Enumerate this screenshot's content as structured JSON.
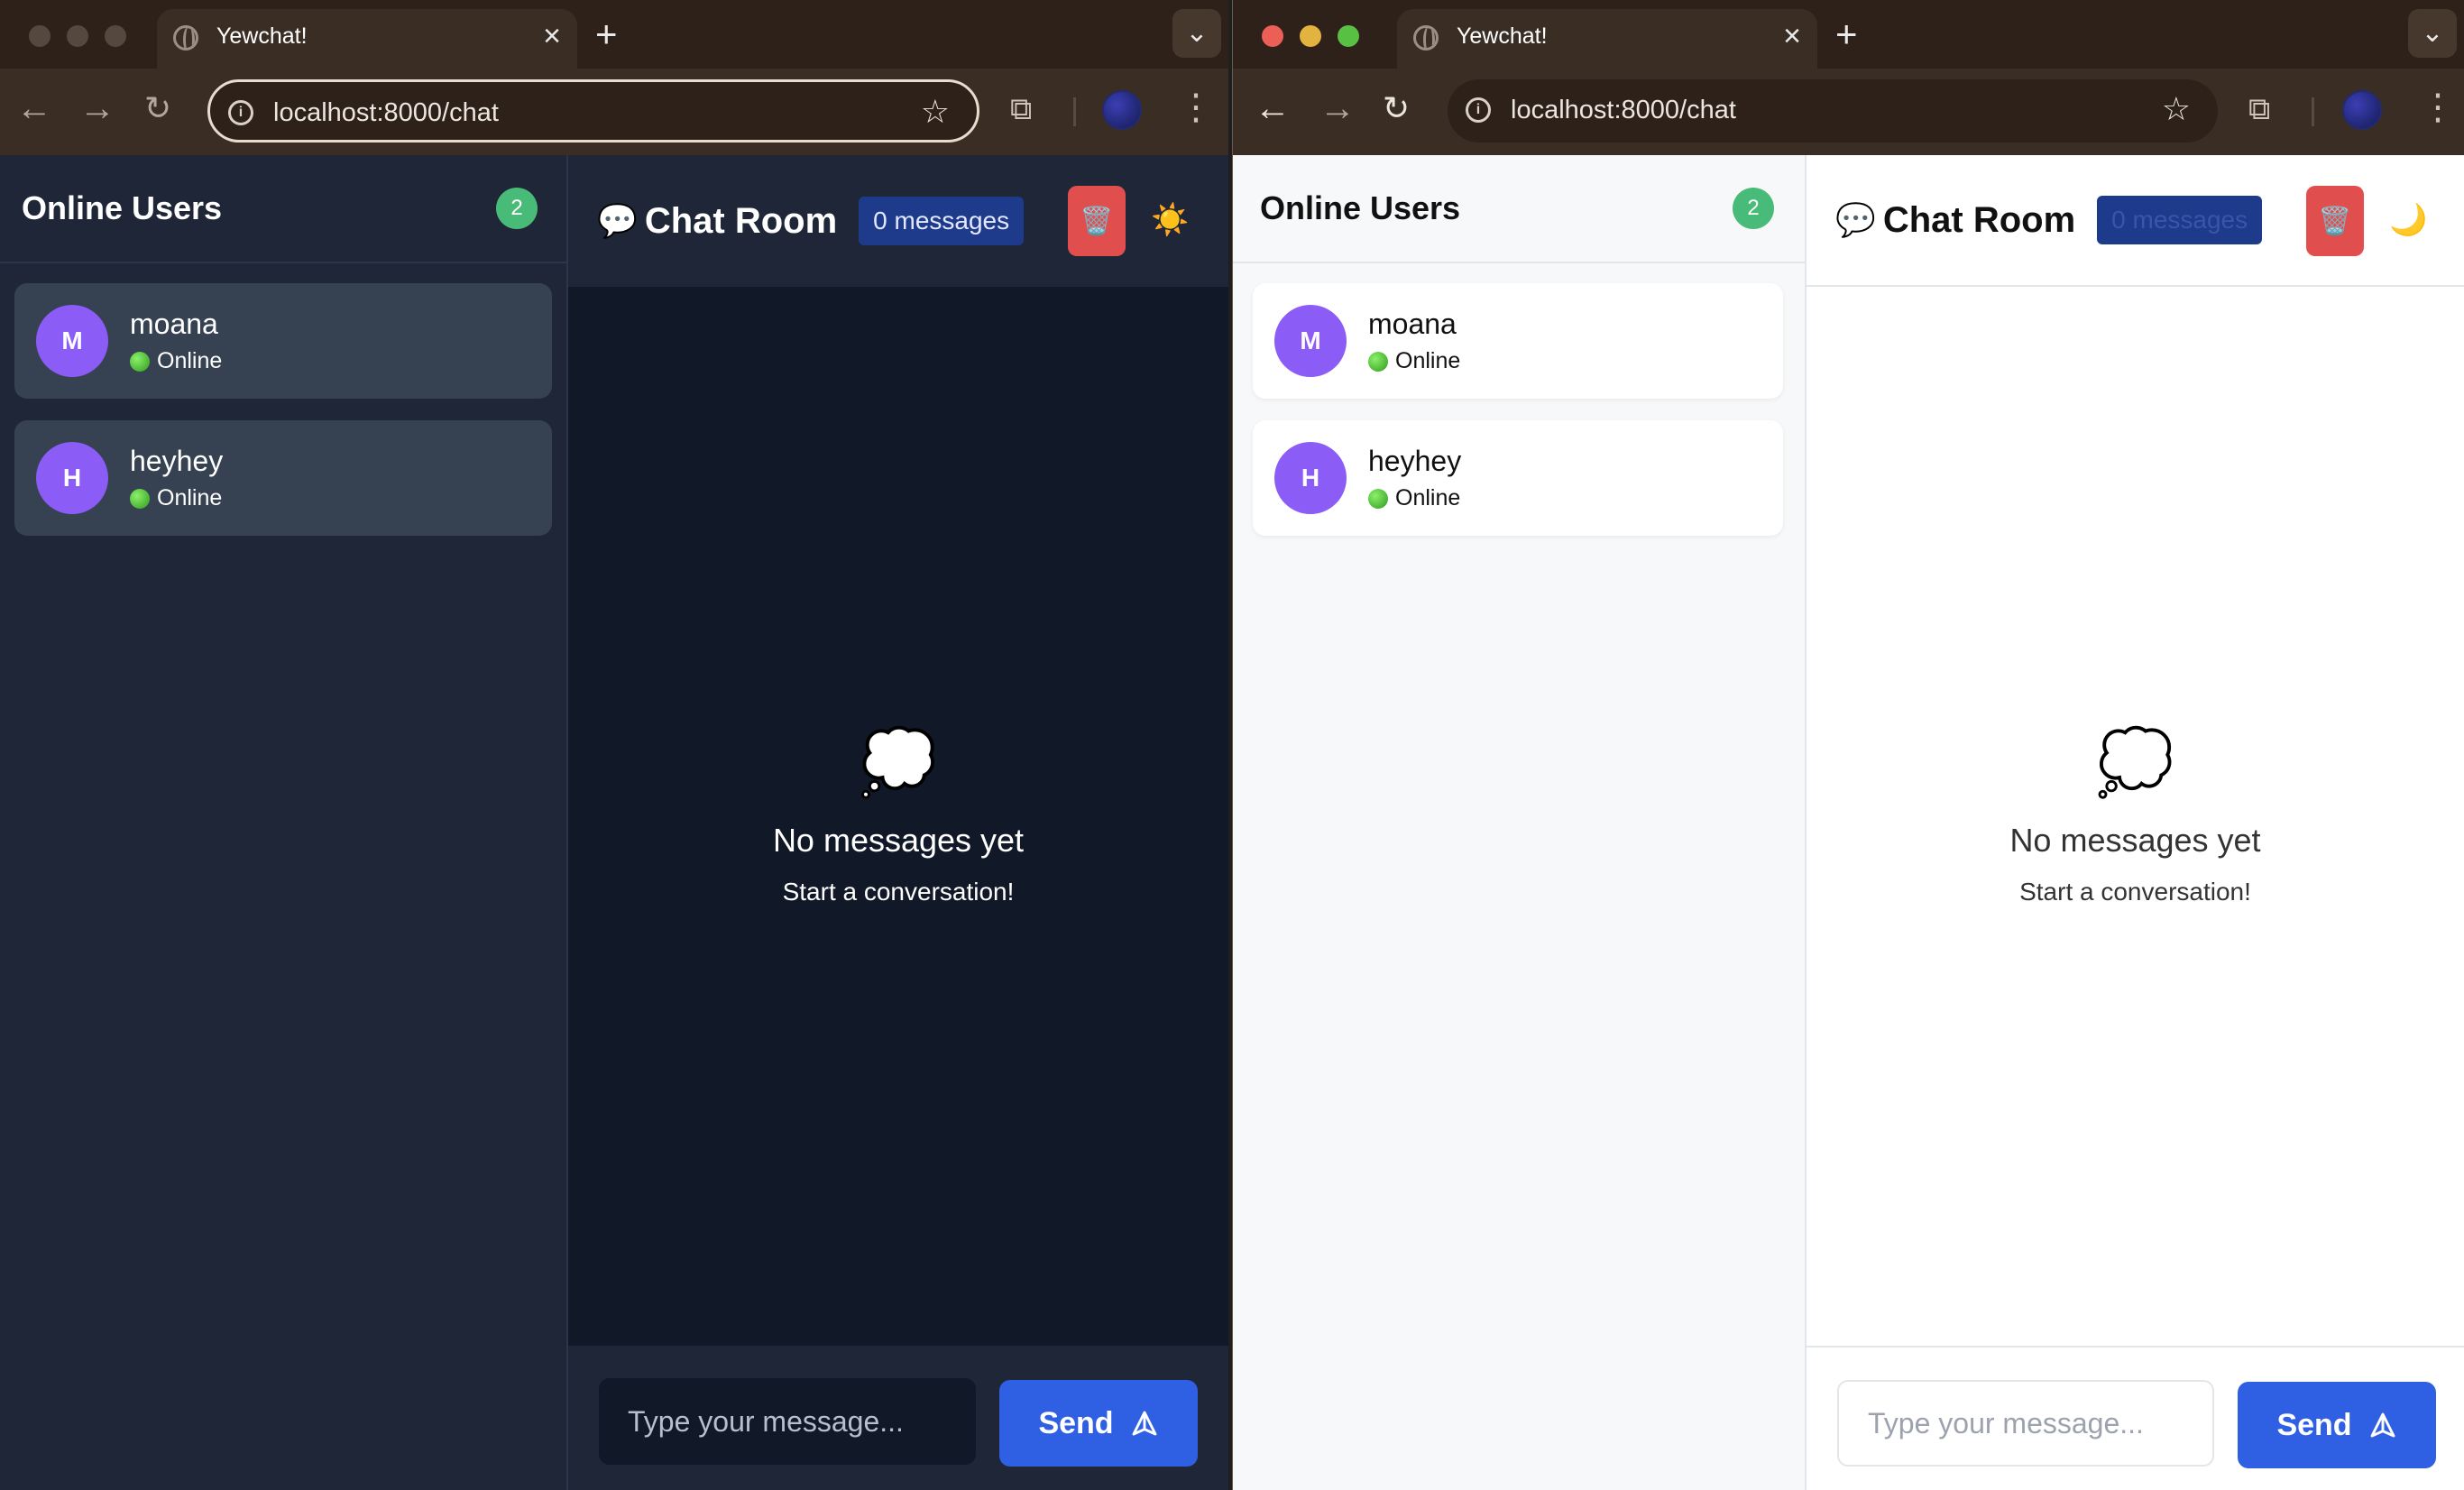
{
  "browser": {
    "tab_title": "Yewchat!",
    "url": "localhost:8000/chat",
    "traffic_colors": {
      "close": "#ec5f57",
      "minimize": "#e2b33f",
      "maximize": "#58c143"
    }
  },
  "sidebar": {
    "title": "Online Users",
    "count": "2",
    "users": [
      {
        "initial": "M",
        "name": "moana",
        "status": "Online"
      },
      {
        "initial": "H",
        "name": "heyhey",
        "status": "Online"
      }
    ]
  },
  "chat": {
    "icon": "💬",
    "title": "Chat Room",
    "message_count": "0 messages",
    "clear_icon": "🗑️",
    "theme_icon_dark": "☀️",
    "theme_icon_light": "🌙",
    "empty_icon": "💭",
    "empty_title": "No messages yet",
    "empty_subtitle": "Start a conversation!",
    "input_placeholder": "Type your message...",
    "send_label": "Send"
  },
  "colors": {
    "accent": "#2f5fe3",
    "avatar": "#8b5cf6",
    "online_badge": "#48bb78",
    "clear_button": "#e04e4e"
  }
}
